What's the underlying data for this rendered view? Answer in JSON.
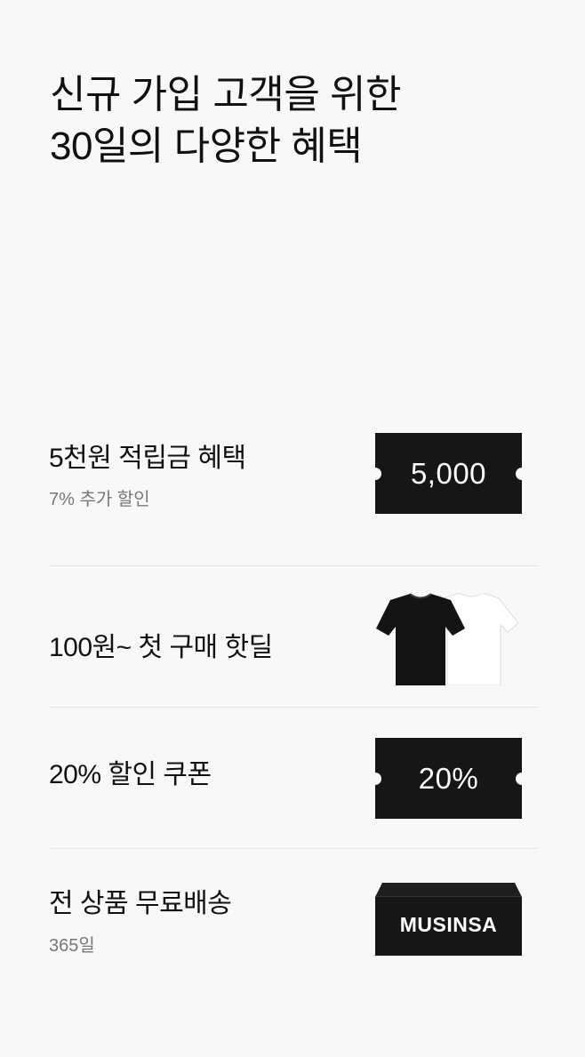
{
  "header": {
    "title_line1": "신규 가입 고객을 위한",
    "title_line2": "30일의 다양한 혜택"
  },
  "benefits": [
    {
      "label": "5천원 적립금 혜택",
      "sub": "7% 추가 할인",
      "visual": "ticket",
      "visual_text": "5,000"
    },
    {
      "label": "100원~ 첫 구매 핫딜",
      "visual": "tshirts-image"
    },
    {
      "label": "20% 할인 쿠폰",
      "visual": "ticket",
      "visual_text": "20%"
    },
    {
      "label": "전 상품 무료배송",
      "sub": "365일",
      "visual": "box",
      "visual_text": "MUSINSA"
    }
  ],
  "colors": {
    "background": "#f8f8f8",
    "ticket": "#161616",
    "divider": "#e6e6e6",
    "subtext": "#777777"
  }
}
